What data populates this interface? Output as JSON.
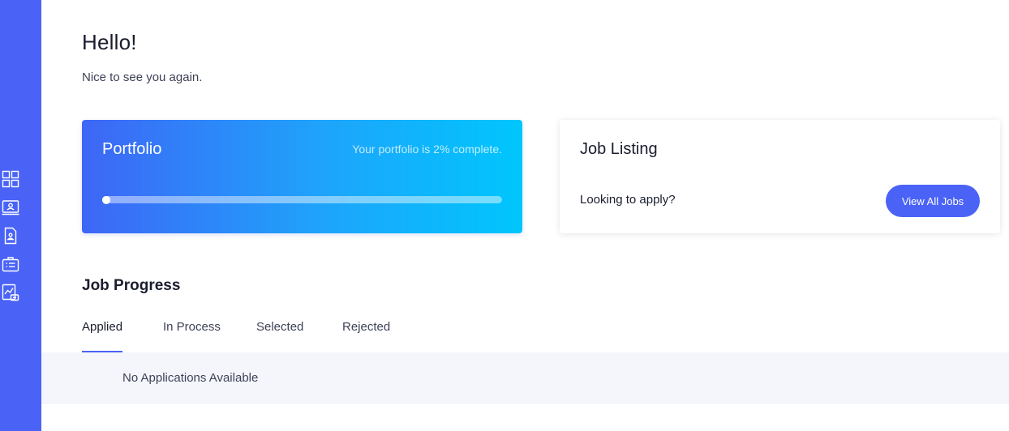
{
  "sidebar": {
    "icons": [
      {
        "name": "dashboard-icon"
      },
      {
        "name": "profile-card-icon"
      },
      {
        "name": "resume-icon"
      },
      {
        "name": "jobs-briefcase-icon"
      },
      {
        "name": "analytics-icon"
      }
    ],
    "accent_color": "#4a63f6"
  },
  "header": {
    "greeting": "Hello!",
    "subgreeting": "Nice to see you again."
  },
  "portfolio": {
    "title": "Portfolio",
    "status_text": "Your portfolio is 2% complete.",
    "progress_percent": 2
  },
  "job_listing": {
    "title": "Job Listing",
    "question": "Looking to apply?",
    "button_label": "View All Jobs"
  },
  "job_progress": {
    "title": "Job Progress",
    "tabs": [
      {
        "label": "Applied",
        "active": true
      },
      {
        "label": "In Process",
        "active": false
      },
      {
        "label": "Selected",
        "active": false
      },
      {
        "label": "Rejected",
        "active": false
      }
    ],
    "empty_message": "No Applications Available"
  }
}
